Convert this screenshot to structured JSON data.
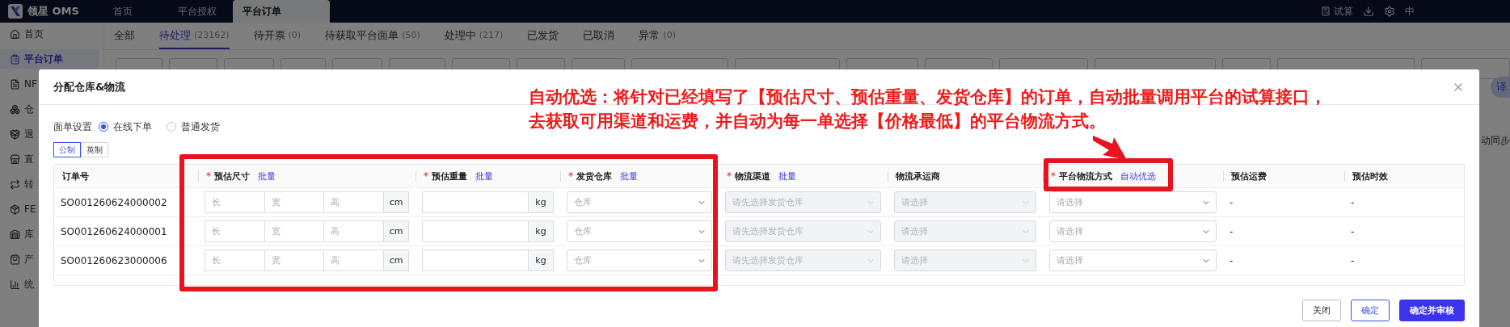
{
  "app": {
    "logo_text": "领星 OMS"
  },
  "top_tabs": [
    {
      "label": "首页",
      "selected": false
    },
    {
      "label": "平台授权",
      "selected": false
    },
    {
      "label": "平台订单",
      "selected": true
    }
  ],
  "top_actions": {
    "calc_label": "试算",
    "language": "中"
  },
  "sidebar": [
    {
      "label": "首页",
      "selected": false
    },
    {
      "label": "平台订单",
      "selected": true
    },
    {
      "label": "NF",
      "selected": false
    },
    {
      "label": "仓",
      "selected": false
    },
    {
      "label": "退",
      "selected": false
    },
    {
      "label": "直",
      "selected": false
    },
    {
      "label": "转",
      "selected": false
    },
    {
      "label": "FE",
      "selected": false
    },
    {
      "label": "库",
      "selected": false
    },
    {
      "label": "产",
      "selected": false
    },
    {
      "label": "统",
      "selected": false
    }
  ],
  "status_tabs": [
    {
      "label": "全部",
      "selected": false
    },
    {
      "label": "待处理",
      "count": "(23162)",
      "selected": true
    },
    {
      "label": "待开票",
      "count": "(0)",
      "selected": false
    },
    {
      "label": "待获取平台面单",
      "count": "(50)",
      "selected": false
    },
    {
      "label": "处理中",
      "count": "(217)",
      "selected": false
    },
    {
      "label": "已发货",
      "selected": false
    },
    {
      "label": "已取消",
      "selected": false
    },
    {
      "label": "异常",
      "count": "(0)",
      "selected": false
    }
  ],
  "side": {
    "translate_badge": "译",
    "sync_text": "动同步"
  },
  "dialog": {
    "title": "分配仓库&物流",
    "sheet_setting": {
      "label": "面单设置",
      "options": [
        {
          "label": "在线下单",
          "selected": true
        },
        {
          "label": "普通发货",
          "selected": false
        }
      ]
    },
    "units": [
      {
        "label": "公制",
        "selected": true
      },
      {
        "label": "英制",
        "selected": false
      }
    ],
    "columns": [
      {
        "label": "订单号"
      },
      {
        "label": "预估尺寸",
        "required_mark": "*",
        "action": "批量"
      },
      {
        "label": "预估重量",
        "required_mark": "*",
        "action": "批量"
      },
      {
        "label": "发货仓库",
        "required_mark": "*",
        "action": "批量"
      },
      {
        "label": "物流渠道",
        "required_mark": "*",
        "action": "批量"
      },
      {
        "label": "物流承运商"
      },
      {
        "label": "平台物流方式",
        "required_mark": "*",
        "action": "自动优选"
      },
      {
        "label": "预估运费"
      },
      {
        "label": "预估时效"
      }
    ],
    "rows": [
      {
        "order_no": "SO001260624000002",
        "dim_placeholders": [
          "长",
          "宽",
          "高"
        ],
        "dim_unit": "cm",
        "weight_unit": "kg",
        "warehouse": {
          "placeholder": "仓库",
          "disabled": false
        },
        "channel": {
          "placeholder": "请先选择发货仓库",
          "disabled": true
        },
        "carrier": {
          "placeholder": "请选择",
          "disabled": true
        },
        "platform": {
          "placeholder": "请选择",
          "disabled": false
        },
        "freight": "-",
        "eta": "-"
      },
      {
        "order_no": "SO001260624000001",
        "dim_placeholders": [
          "长",
          "宽",
          "高"
        ],
        "dim_unit": "cm",
        "weight_unit": "kg",
        "warehouse": {
          "placeholder": "仓库",
          "disabled": false
        },
        "channel": {
          "placeholder": "请先选择发货仓库",
          "disabled": true
        },
        "carrier": {
          "placeholder": "请选择",
          "disabled": true
        },
        "platform": {
          "placeholder": "请选择",
          "disabled": false
        },
        "freight": "-",
        "eta": "-"
      },
      {
        "order_no": "SO001260623000006",
        "dim_placeholders": [
          "长",
          "宽",
          "高"
        ],
        "dim_unit": "cm",
        "weight_unit": "kg",
        "warehouse": {
          "placeholder": "仓库",
          "disabled": false
        },
        "channel": {
          "placeholder": "请先选择发货仓库",
          "disabled": true
        },
        "carrier": {
          "placeholder": "请选择",
          "disabled": true
        },
        "platform": {
          "placeholder": "请选择",
          "disabled": false
        },
        "freight": "-",
        "eta": "-"
      }
    ],
    "buttons": [
      {
        "label": "关闭",
        "kind": "default"
      },
      {
        "label": "确定",
        "kind": "outline"
      },
      {
        "label": "确定并审核",
        "kind": "primary"
      }
    ]
  },
  "annotation": {
    "lines": [
      "自动优选：将针对已经填写了【预估尺寸、预估重量、发货仓库】的订单，自动批量调用平台的试算接口，",
      "去获取可用渠道和运费，并自动为每一单选择【价格最低】的平台物流方式。"
    ]
  }
}
